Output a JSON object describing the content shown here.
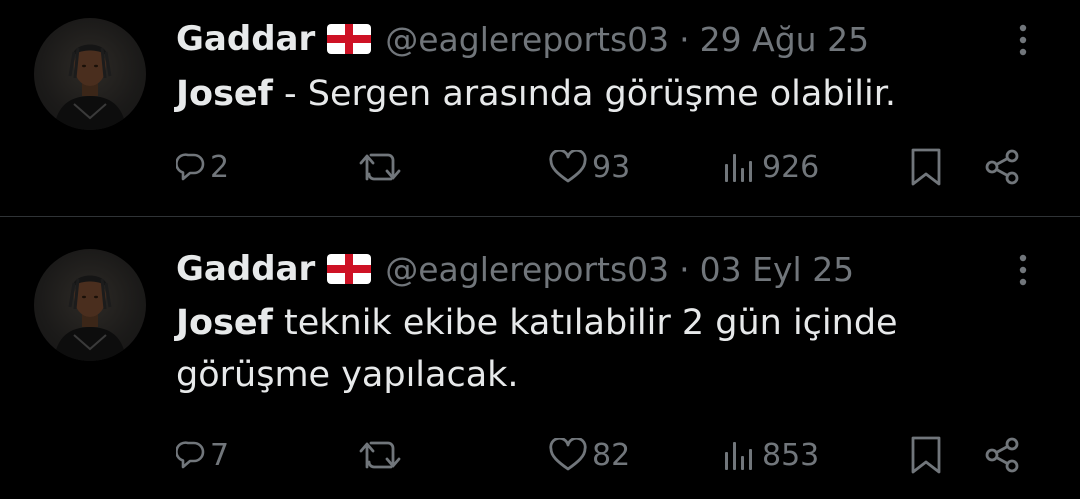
{
  "tweets": [
    {
      "author": "Gaddar",
      "handle": "@eaglereports03",
      "separator": "·",
      "date": "29 Ağu 25",
      "bold_text": "Josef",
      "text": " - Sergen arasında görüşme olabilir.",
      "replies": "2",
      "likes": "93",
      "views": "926"
    },
    {
      "author": "Gaddar",
      "handle": "@eaglereports03",
      "separator": "·",
      "date": "03 Eyl 25",
      "bold_text": "Josef",
      "text": " teknik ekibe katılabilir 2 gün içinde görüşme yapılacak.",
      "replies": "7",
      "likes": "82",
      "views": "853"
    }
  ],
  "icons": {
    "flag": "england-flag-icon",
    "more": "more-options-icon",
    "reply": "reply-icon",
    "retweet": "retweet-icon",
    "like": "like-heart-icon",
    "views": "views-chart-icon",
    "bookmark": "bookmark-icon",
    "share": "share-icon"
  },
  "colors": {
    "background": "#000000",
    "text": "#e7e9ea",
    "secondary": "#71767b",
    "divider": "#2f3336",
    "flag_red": "#ce1124"
  }
}
